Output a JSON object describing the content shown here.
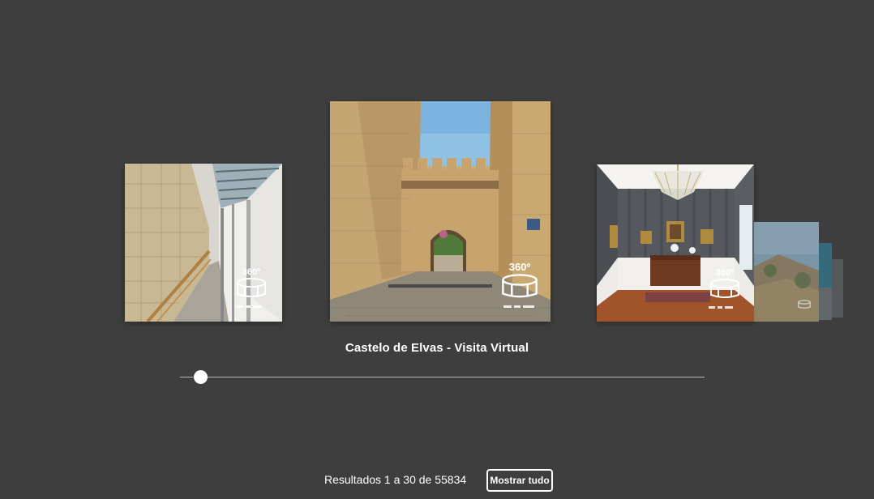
{
  "carousel": {
    "items": [
      {
        "id": "left",
        "badge": "360º"
      },
      {
        "id": "center",
        "badge": "360º"
      },
      {
        "id": "right",
        "badge": "360º"
      },
      {
        "id": "far1",
        "badge": ""
      }
    ],
    "active_title": "Castelo de Elvas - Visita Virtual",
    "slider_position": 0.04
  },
  "footer": {
    "results_text": "Resultados 1 a 30 de 55834",
    "show_all_label": "Mostrar tudo"
  },
  "colors": {
    "background": "#3e3e3e",
    "text": "#ffffff",
    "track": "#b8b8b8"
  }
}
